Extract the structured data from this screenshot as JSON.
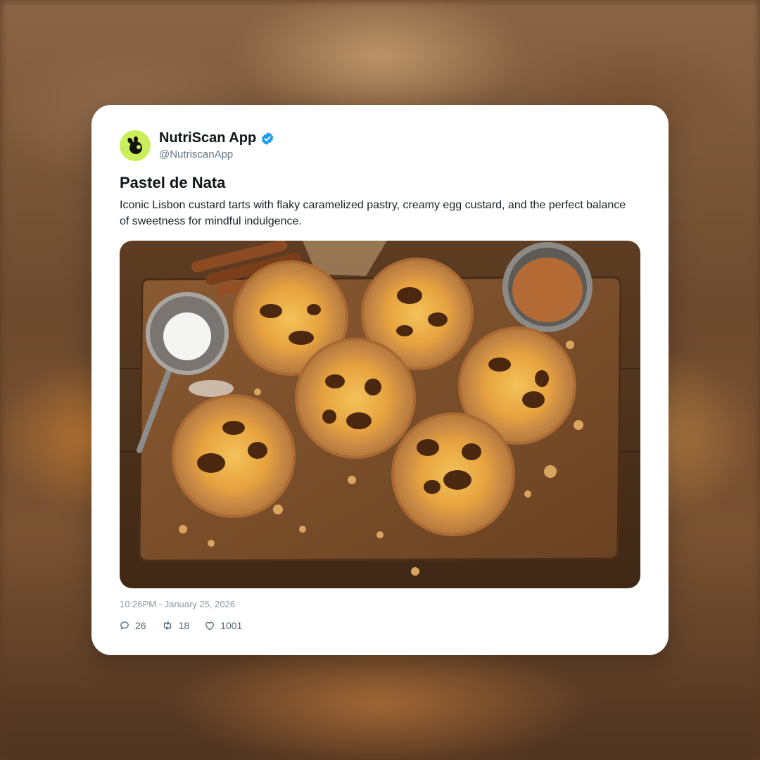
{
  "post": {
    "author_name": "NutriScan App",
    "author_handle": "@NutriscanApp",
    "title": "Pastel de Nata",
    "description": "Iconic Lisbon custard tarts with flaky caramelized pastry, creamy egg custard, and the perfect balance of sweetness for mindful indulgence.",
    "timestamp": "10:26PM - January 25, 2026",
    "photo_subject": "pastel-de-nata-tarts-on-wooden-board"
  },
  "actions": {
    "replies": "26",
    "reposts": "18",
    "likes": "1001"
  },
  "icons": {
    "avatar": "nutriscan-logo-icon",
    "verified": "verified-badge-icon",
    "reply": "comment-icon",
    "repost": "repost-icon",
    "like": "heart-icon"
  },
  "colors": {
    "avatar_bg": "#c9ee5a",
    "verified": "#1d9bf0",
    "text_primary": "#0f1419",
    "text_secondary": "#657786"
  }
}
